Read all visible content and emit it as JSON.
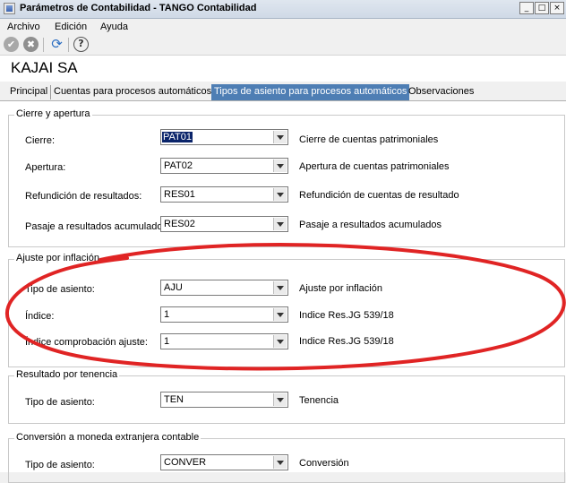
{
  "window": {
    "title": "Parámetros de Contabilidad - TANGO Contabilidad",
    "controls": {
      "minimize": "_",
      "maximize": "□",
      "close": "×"
    }
  },
  "menu": {
    "items": [
      "Archivo",
      "Edición",
      "Ayuda"
    ]
  },
  "toolbar": {
    "buttons": [
      {
        "icon": "check-circle-icon",
        "glyph": "✔"
      },
      {
        "icon": "cancel-circle-icon",
        "glyph": "✖"
      },
      {
        "icon": "refresh-icon",
        "glyph": "⟳"
      },
      {
        "icon": "help-icon",
        "glyph": "?"
      }
    ]
  },
  "company": {
    "name": "KAJAI SA"
  },
  "tabs": [
    {
      "label": "Principal",
      "active": false
    },
    {
      "label": "Cuentas para procesos automáticos",
      "active": false
    },
    {
      "label": "Tipos de asiento para procesos automáticos",
      "active": true
    },
    {
      "label": "Observaciones",
      "active": false
    }
  ],
  "groups": [
    {
      "title": "Cierre y apertura",
      "rows": [
        {
          "label": "Cierre:",
          "value": "PAT01",
          "description": "Cierre de cuentas patrimoniales",
          "selected": true
        },
        {
          "label": "Apertura:",
          "value": "PAT02",
          "description": "Apertura de cuentas patrimoniales"
        },
        {
          "label": "Refundición de resultados:",
          "value": "RES01",
          "description": "Refundición de cuentas de resultado"
        },
        {
          "label": "Pasaje a resultados acumulados:",
          "value": "RES02",
          "description": "Pasaje a resultados acumulados"
        }
      ]
    },
    {
      "title": "Ajuste por inflación",
      "rows": [
        {
          "label": "Tipo de asiento:",
          "value": "AJU",
          "description": "Ajuste por inflación"
        },
        {
          "label": "Índice:",
          "value": "1",
          "description": "Indice Res.JG 539/18"
        },
        {
          "label": "Índice comprobación ajuste:",
          "value": "1",
          "description": "Indice Res.JG 539/18"
        }
      ]
    },
    {
      "title": "Resultado por tenencia",
      "rows": [
        {
          "label": "Tipo de asiento:",
          "value": "TEN",
          "description": "Tenencia"
        }
      ]
    },
    {
      "title": "Conversión a moneda extranjera contable",
      "rows": [
        {
          "label": "Tipo de asiento:",
          "value": "CONVER",
          "description": "Conversión"
        }
      ]
    }
  ],
  "colors": {
    "annotation": "#e02424",
    "active_tab": "#4e7eb4"
  }
}
